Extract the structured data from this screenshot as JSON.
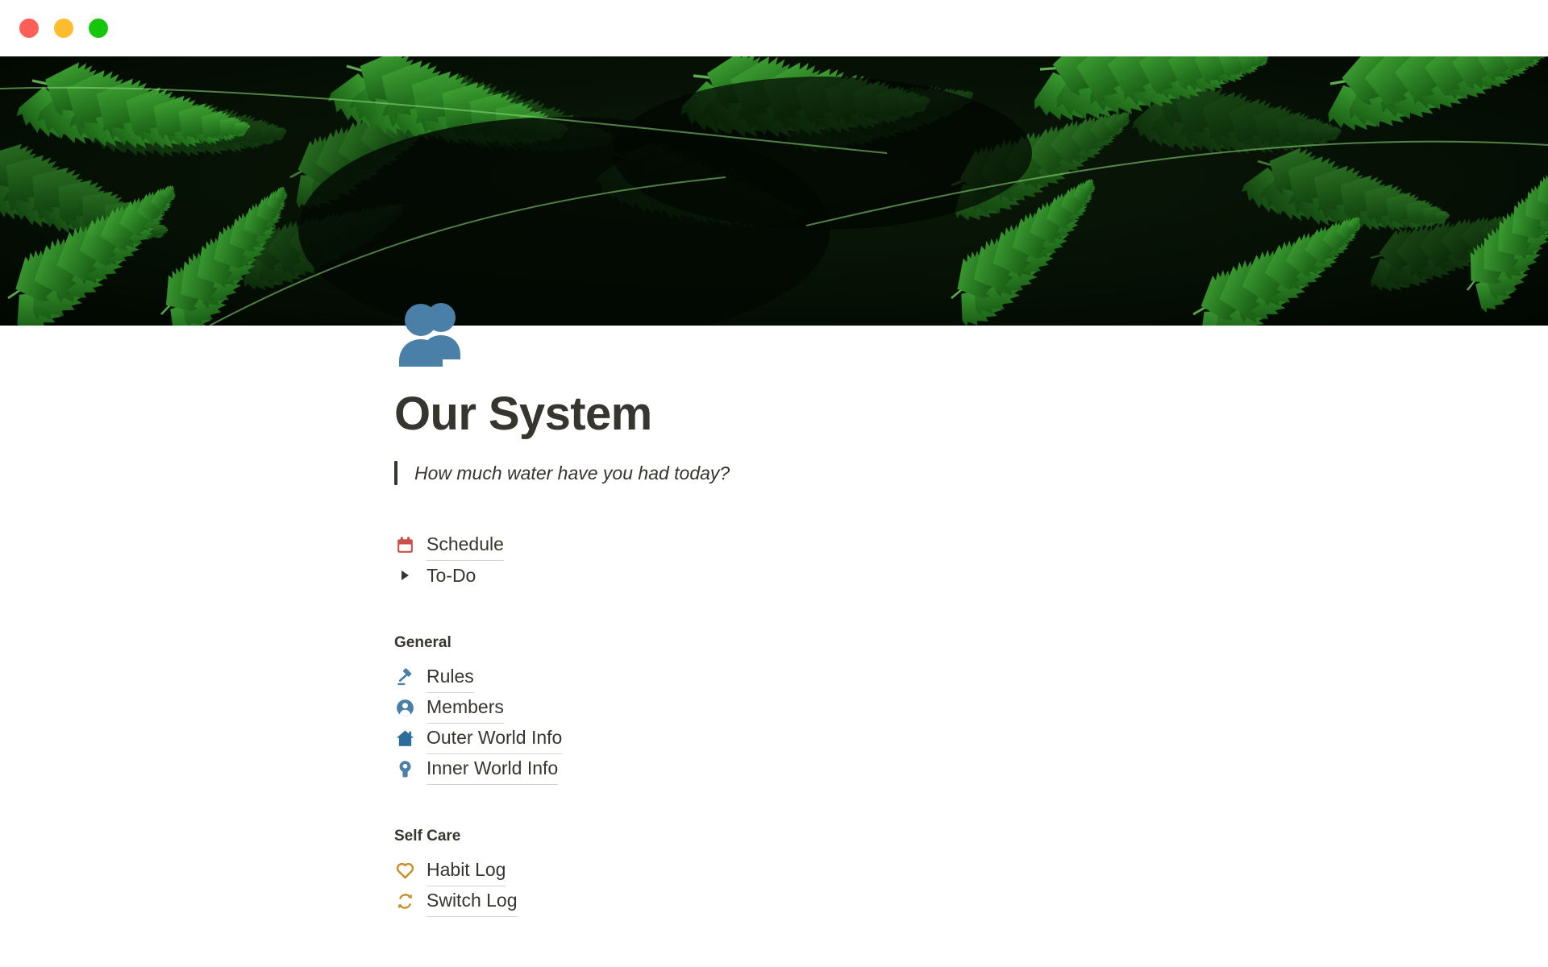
{
  "window": {
    "traffic_lights": [
      {
        "name": "close",
        "color": "#FF5F57"
      },
      {
        "name": "minimize",
        "color": "#FFBD2E"
      },
      {
        "name": "maximize",
        "color": "#16C60C"
      }
    ]
  },
  "cover": {
    "description": "dark green fern fronds photograph",
    "background": "#050c04",
    "leaf_color": "#1f7a1f"
  },
  "page": {
    "icon": "busts-in-silhouette-emoji",
    "icon_color": "#4A7FA8",
    "title": "Our System",
    "quote": "How much water have you had today?"
  },
  "blocks": [
    {
      "type": "link",
      "icon": "calendar-icon",
      "icon_color": "#C9534C",
      "label": "Schedule"
    },
    {
      "type": "toggle",
      "icon": "triangle-right-icon",
      "icon_color": "#37352F",
      "label": "To-Do",
      "expanded": false
    }
  ],
  "sections": [
    {
      "heading": "General",
      "items": [
        {
          "icon": "gavel-icon",
          "icon_color": "#4A7FA8",
          "label": "Rules"
        },
        {
          "icon": "person-circle-icon",
          "icon_color": "#4A7FA8",
          "label": "Members"
        },
        {
          "icon": "house-icon",
          "icon_color": "#2C6E9B",
          "label": "Outer World Info"
        },
        {
          "icon": "keyhole-person-icon",
          "icon_color": "#4A7FA8",
          "label": "Inner World Info"
        }
      ]
    },
    {
      "heading": "Self Care",
      "items": [
        {
          "icon": "heart-outline-icon",
          "icon_color": "#C8912F",
          "label": "Habit Log"
        },
        {
          "icon": "repeat-arrows-icon",
          "icon_color": "#C8912F",
          "label": "Switch Log"
        }
      ]
    }
  ],
  "colors": {
    "text": "#37352F",
    "page_background": "#FFFFFF",
    "link_underline": "rgba(55,53,47,0.22)"
  }
}
